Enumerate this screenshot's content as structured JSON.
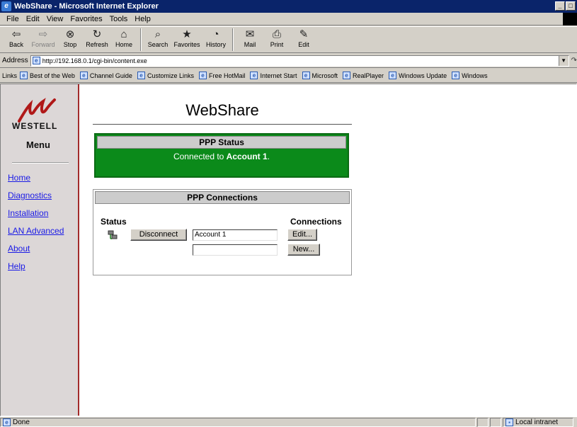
{
  "window": {
    "title": "WebShare - Microsoft Internet Explorer",
    "controls": [
      "_",
      "□"
    ]
  },
  "menubar": [
    "File",
    "Edit",
    "View",
    "Favorites",
    "Tools",
    "Help"
  ],
  "toolbar": [
    {
      "label": "Back",
      "icon": "back-arrow-icon",
      "glyph": "⇦",
      "enabled": true
    },
    {
      "label": "Forward",
      "icon": "forward-arrow-icon",
      "glyph": "⇨",
      "enabled": false
    },
    {
      "label": "Stop",
      "icon": "stop-icon",
      "glyph": "⊗",
      "enabled": true
    },
    {
      "label": "Refresh",
      "icon": "refresh-icon",
      "glyph": "↻",
      "enabled": true
    },
    {
      "label": "Home",
      "icon": "home-icon",
      "glyph": "⌂",
      "enabled": true
    },
    {
      "label": "Search",
      "icon": "search-icon",
      "glyph": "⌕",
      "enabled": true
    },
    {
      "label": "Favorites",
      "icon": "favorites-icon",
      "glyph": "★",
      "enabled": true
    },
    {
      "label": "History",
      "icon": "history-icon",
      "glyph": "◔",
      "enabled": true
    },
    {
      "label": "Mail",
      "icon": "mail-icon",
      "glyph": "✉",
      "enabled": true
    },
    {
      "label": "Print",
      "icon": "print-icon",
      "glyph": "⎙",
      "enabled": true
    },
    {
      "label": "Edit",
      "icon": "edit-icon",
      "glyph": "✎",
      "enabled": true
    }
  ],
  "address": {
    "label": "Address",
    "url": "http://192.168.0.1/cgi-bin/content.exe"
  },
  "links": {
    "label": "Links",
    "items": [
      "Best of the Web",
      "Channel Guide",
      "Customize Links",
      "Free HotMail",
      "Internet Start",
      "Microsoft",
      "RealPlayer",
      "Windows Update",
      "Windows"
    ]
  },
  "sidebar": {
    "logo_text": "WESTELL",
    "menu_title": "Menu",
    "links": [
      "Home",
      "Diagnostics",
      "Installation",
      "LAN Advanced",
      "About",
      "Help"
    ]
  },
  "page": {
    "title": "WebShare",
    "ppp_status": {
      "header": "PPP Status",
      "message_prefix": "Connected to ",
      "account": "Account 1",
      "message_suffix": "."
    },
    "ppp_connections": {
      "header": "PPP Connections",
      "status_label": "Status",
      "connections_label": "Connections",
      "disconnect_label": "Disconnect",
      "account_value": "Account 1",
      "empty_value": "",
      "edit_label": "Edit...",
      "new_label": "New..."
    }
  },
  "statusbar": {
    "text": "Done",
    "zone": "Local intranet"
  },
  "colors": {
    "titlebar": "#0a246a",
    "status_green": "#0b8a1a",
    "sidebar_border": "#a22a2a",
    "link": "#1a1ae6"
  }
}
